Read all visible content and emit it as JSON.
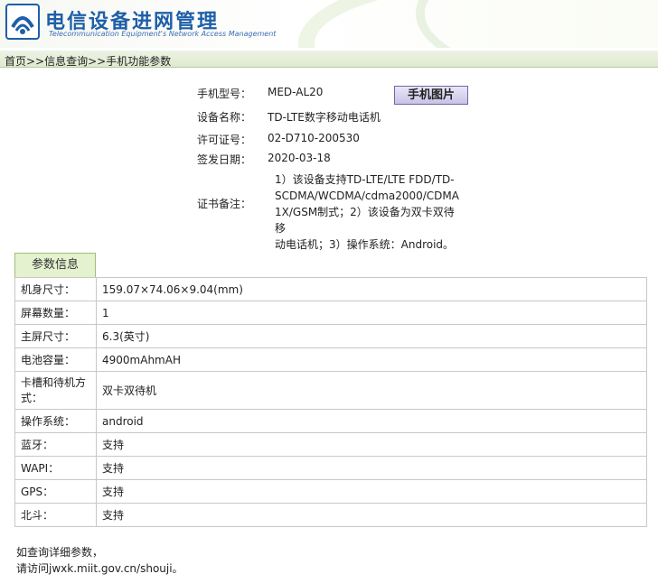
{
  "header": {
    "title": "电信设备进网管理",
    "subtitle": "Telecommunication Equipment's Network Access Management"
  },
  "breadcrumb": "首页>>信息查询>>手机功能参数",
  "certificate": {
    "rows": [
      {
        "label": "手机型号：",
        "value": "MED-AL20"
      },
      {
        "label": "设备名称：",
        "value": "TD-LTE数字移动电话机"
      },
      {
        "label": "许可证号：",
        "value": "02-D710-200530"
      },
      {
        "label": "签发日期：",
        "value": "2020-03-18"
      }
    ],
    "note_label": "证书备注：",
    "note_lines": [
      "1）该设备支持TD-LTE/LTE FDD/TD-",
      "SCDMA/WCDMA/cdma2000/CDMA",
      "1X/GSM制式；2）该设备为双卡双待移",
      "动电话机；3）操作系统：Android。"
    ],
    "photo_button": "手机图片"
  },
  "params": {
    "tab_label": "参数信息",
    "rows": [
      {
        "key": "机身尺寸：",
        "value": "159.07×74.06×9.04(mm)"
      },
      {
        "key": "屏幕数量：",
        "value": "1"
      },
      {
        "key": "主屏尺寸：",
        "value": "6.3(英寸)"
      },
      {
        "key": "电池容量：",
        "value": "4900mAhmAH"
      },
      {
        "key_line1": "卡槽和待机方",
        "key_line2": "式：",
        "value": "双卡双待机"
      },
      {
        "key": "操作系统：",
        "value": "android"
      },
      {
        "key": "蓝牙：",
        "value": "支持"
      },
      {
        "key": "WAPI：",
        "value": "支持"
      },
      {
        "key": "GPS：",
        "value": "支持"
      },
      {
        "key": "北斗：",
        "value": "支持"
      }
    ]
  },
  "footer": {
    "line1": "如查询详细参数，",
    "line2": "请访问jwxk.miit.gov.cn/shouji。"
  },
  "colors": {
    "title_blue": "#1e5fa8",
    "breadcrumb_bg": "#dfe9cf",
    "tab_bg": "#e4f2cf",
    "button_bg": "#c9c3e6"
  }
}
